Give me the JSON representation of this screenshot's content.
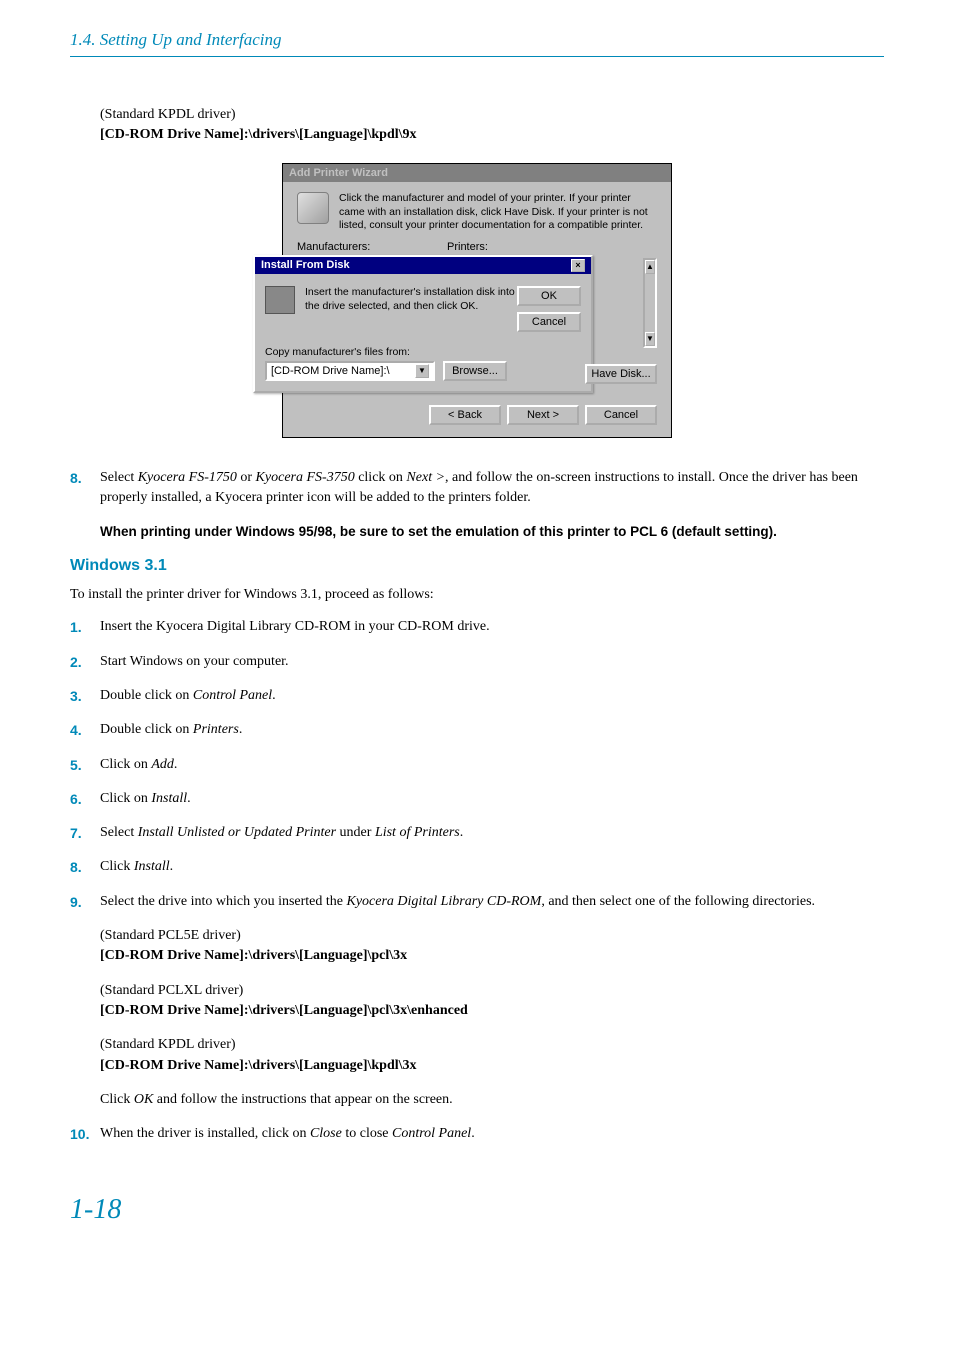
{
  "header": {
    "section": "1.4. Setting Up and Interfacing"
  },
  "topDriver": {
    "note": "(Standard KPDL driver)",
    "path": "[CD-ROM Drive Name]:\\drivers\\[Language]\\kpdl\\9x"
  },
  "wizard": {
    "title": "Add Printer Wizard",
    "desc": "Click the manufacturer and model of your printer. If your printer came with an installation disk, click Have Disk. If your printer is not listed, consult your printer documentation for a compatible printer.",
    "manufacturersLabel": "Manufacturers:",
    "printersLabel": "Printers:",
    "haveDisk": "Have Disk...",
    "back": "< Back",
    "next": "Next >",
    "cancel": "Cancel"
  },
  "installDialog": {
    "title": "Install From Disk",
    "text": "Insert the manufacturer's installation disk into the drive selected, and then click OK.",
    "ok": "OK",
    "cancel": "Cancel",
    "copyLabel": "Copy manufacturer's files from:",
    "comboValue": "[CD-ROM Drive Name]:\\",
    "browse": "Browse..."
  },
  "step8": {
    "num": "8.",
    "prefix": "Select ",
    "model1": "Kyocera FS-1750",
    "or": " or ",
    "model2": "Kyocera FS-3750",
    "mid": " click on ",
    "next": "Next >",
    "rest": ", and follow the on-screen instructions to install. Once the driver has been properly installed, a Kyocera printer icon will be added to the printers folder."
  },
  "warningText": "When printing under Windows 95/98, be sure to set the emulation of this printer to PCL 6 (default setting).",
  "winSection": {
    "title": "Windows 3.1",
    "intro": "To install the printer driver for Windows 3.1, proceed as follows:"
  },
  "steps": {
    "s1": {
      "num": "1.",
      "text": "Insert the Kyocera Digital Library CD-ROM in your CD-ROM drive."
    },
    "s2": {
      "num": "2.",
      "text": "Start Windows on your computer."
    },
    "s3": {
      "num": "3.",
      "pre": "Double click on ",
      "it": "Control Panel",
      "post": "."
    },
    "s4": {
      "num": "4.",
      "pre": "Double click on ",
      "it": "Printers",
      "post": "."
    },
    "s5": {
      "num": "5.",
      "pre": "Click on ",
      "it": "Add",
      "post": "."
    },
    "s6": {
      "num": "6.",
      "pre": "Click on ",
      "it": "Install",
      "post": "."
    },
    "s7": {
      "num": "7.",
      "pre": "Select ",
      "it1": "Install Unlisted or Updated Printer",
      "mid": " under ",
      "it2": "List of Printers",
      "post": "."
    },
    "s8": {
      "num": "8.",
      "pre": "Click ",
      "it": "Install",
      "post": "."
    },
    "s9": {
      "num": "9.",
      "pre": "Select the drive into which you inserted the ",
      "it": "Kyocera Digital Library CD-ROM",
      "post": ", and then select one of the following directories."
    },
    "s9drivers": {
      "d1": {
        "note": "(Standard PCL5E driver)",
        "path": "[CD-ROM Drive Name]:\\drivers\\[Language]\\pcl\\3x"
      },
      "d2": {
        "note": "(Standard PCLXL driver)",
        "path": "[CD-ROM Drive Name]:\\drivers\\[Language]\\pcl\\3x\\enhanced"
      },
      "d3": {
        "note": "(Standard KPDL driver)",
        "path": "[CD-ROM Drive Name]:\\drivers\\[Language]\\kpdl\\3x"
      },
      "click": {
        "pre": "Click ",
        "it": "OK",
        "post": " and follow the instructions that appear on the screen."
      }
    },
    "s10": {
      "num": "10.",
      "pre": "When the driver is installed, click on ",
      "it1": "Close",
      "mid": " to close ",
      "it2": "Control Panel",
      "post": "."
    }
  },
  "pageNumber": "1-18"
}
